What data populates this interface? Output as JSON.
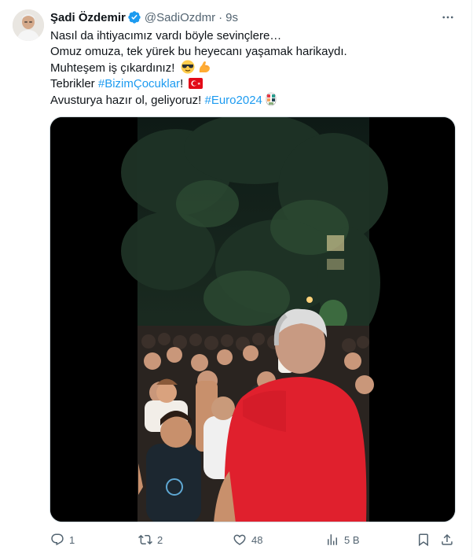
{
  "author": {
    "name": "Şadi Özdemir",
    "handle": "@SadiOzdmr",
    "separator": "·",
    "time": "9s"
  },
  "tweet": {
    "line1": "Nasıl da ihtiyacımız vardı böyle sevinçlere…",
    "line2": "Omuz omuza, tek yürek bu heyecanı yaşamak harikaydı.",
    "line3_text": "Muhteşem iş çıkardınız! ",
    "line4_prefix": "Tebrikler ",
    "line4_hashtag": "#BizimÇocuklar",
    "line4_suffix": "! ",
    "line5_prefix": "Avusturya hazır ol, geliyoruz! ",
    "line5_hashtag": "#Euro2024"
  },
  "emojis": [
    "sunglasses-emoji",
    "flexed-biceps-emoji",
    "turkey-flag-emoji",
    "euro2024-emoji"
  ],
  "actions": {
    "reply_count": "1",
    "retweet_count": "2",
    "like_count": "48",
    "views_count": "5 B"
  },
  "colors": {
    "accent": "#1d9bf0",
    "text": "#0f1419",
    "muted": "#536471",
    "verified": "#1d9bf0",
    "shirt": "#e0202d"
  }
}
